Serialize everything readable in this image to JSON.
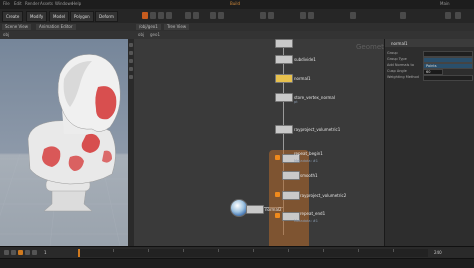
{
  "menubar": {
    "items": [
      "File",
      "Edit",
      "Render",
      "Assets",
      "Windows",
      "Help",
      "Build",
      "Main"
    ]
  },
  "shelf": {
    "tabs": [
      "Create",
      "Modify",
      "Model",
      "Polygon",
      "Deform"
    ]
  },
  "viewport": {
    "tabs": [
      "Scene View",
      "Animation Editor"
    ],
    "bar_label": "obj"
  },
  "network": {
    "tabs": [
      "/obj/geo1",
      "Tree View"
    ],
    "path": [
      "obj",
      "geo1"
    ],
    "context_watermark": "Geometry",
    "nodes": [
      {
        "label": "",
        "sub": ""
      },
      {
        "label": "subdivide1",
        "sub": ""
      },
      {
        "label": "normal1",
        "sub": ""
      },
      {
        "label": "store_vertex_normal",
        "sub": "pt"
      },
      {
        "label": "rayproject_volumetric1",
        "sub": ""
      },
      {
        "label": "repeat_begin1",
        "sub": "Metadata: #1"
      },
      {
        "label": "smooth1",
        "sub": ""
      },
      {
        "label": "rayproject_volumetric2",
        "sub": ""
      },
      {
        "label": "repeat_end1",
        "sub": "Metadata: #1"
      },
      {
        "label": "normal2",
        "sub": ""
      }
    ]
  },
  "params": {
    "node_name": "normal1",
    "rows": [
      {
        "label": "Group",
        "value": ""
      },
      {
        "label": "Group Type",
        "value": ""
      },
      {
        "label": "Add Normals to",
        "value": "Points"
      },
      {
        "label": "Cusp Angle",
        "value": "60"
      },
      {
        "label": "Weighting Method",
        "value": ""
      }
    ]
  },
  "timeline": {
    "frame": "1",
    "end_frame": "240"
  },
  "colors": {
    "accent": "#f08a1c",
    "selected_node": "#e7c14e",
    "paint": "#d43333"
  }
}
